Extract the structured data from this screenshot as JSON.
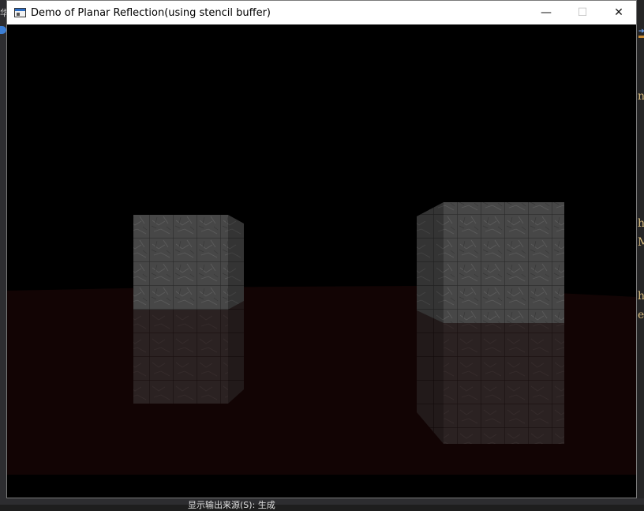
{
  "window": {
    "title": "Demo of Planar Reflection(using stencil buffer)",
    "minimize_glyph": "—",
    "maximize_glyph": "☐",
    "close_glyph": "✕"
  },
  "background": {
    "left_glyph": "华",
    "right_fragments": [
      "n",
      "h",
      "M",
      "h",
      "e"
    ],
    "status_text": "显示输出来源(S):   生成"
  },
  "colors": {
    "scene_background": "#000000",
    "floor": "#120404",
    "cube_face": "#4a4a4a"
  }
}
